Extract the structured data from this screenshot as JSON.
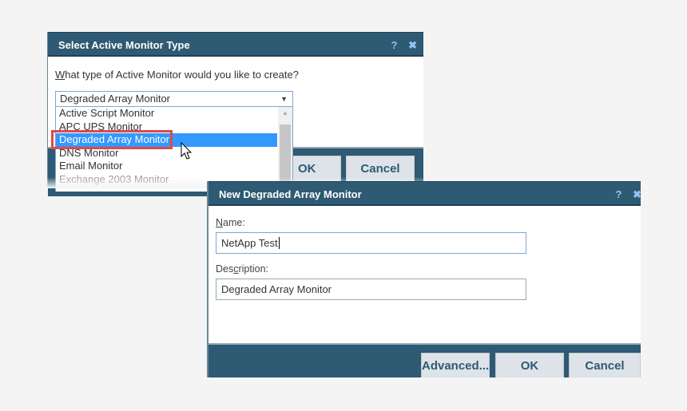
{
  "dialog1": {
    "title": "Select Active Monitor Type",
    "help_icon": "?",
    "close_icon": "✖",
    "prompt_accel": "W",
    "prompt_rest": "hat type of Active Monitor would you like to create?",
    "selected_value": "Degraded Array Monitor",
    "options": [
      "Active Script Monitor",
      "APC UPS Monitor",
      "Degraded Array Monitor",
      "DNS Monitor",
      "Email Monitor",
      "Exchange 2003 Monitor"
    ],
    "highlighted_index": 2,
    "ok_label": "OK",
    "cancel_label": "Cancel"
  },
  "dialog2": {
    "title": "New Degraded Array Monitor",
    "help_icon": "?",
    "close_icon": "✖",
    "name_label_accel": "N",
    "name_label_rest": "ame:",
    "name_value": "NetApp Test",
    "desc_label_pre": "Des",
    "desc_label_accel": "c",
    "desc_label_rest": "ription:",
    "desc_value": "Degraded Array Monitor",
    "advanced_label": "Advanced...",
    "ok_label": "OK",
    "cancel_label": "Cancel"
  },
  "colors": {
    "titlebar": "#2e5a73",
    "selection": "#3399ff",
    "highlight_box": "#e04848"
  }
}
